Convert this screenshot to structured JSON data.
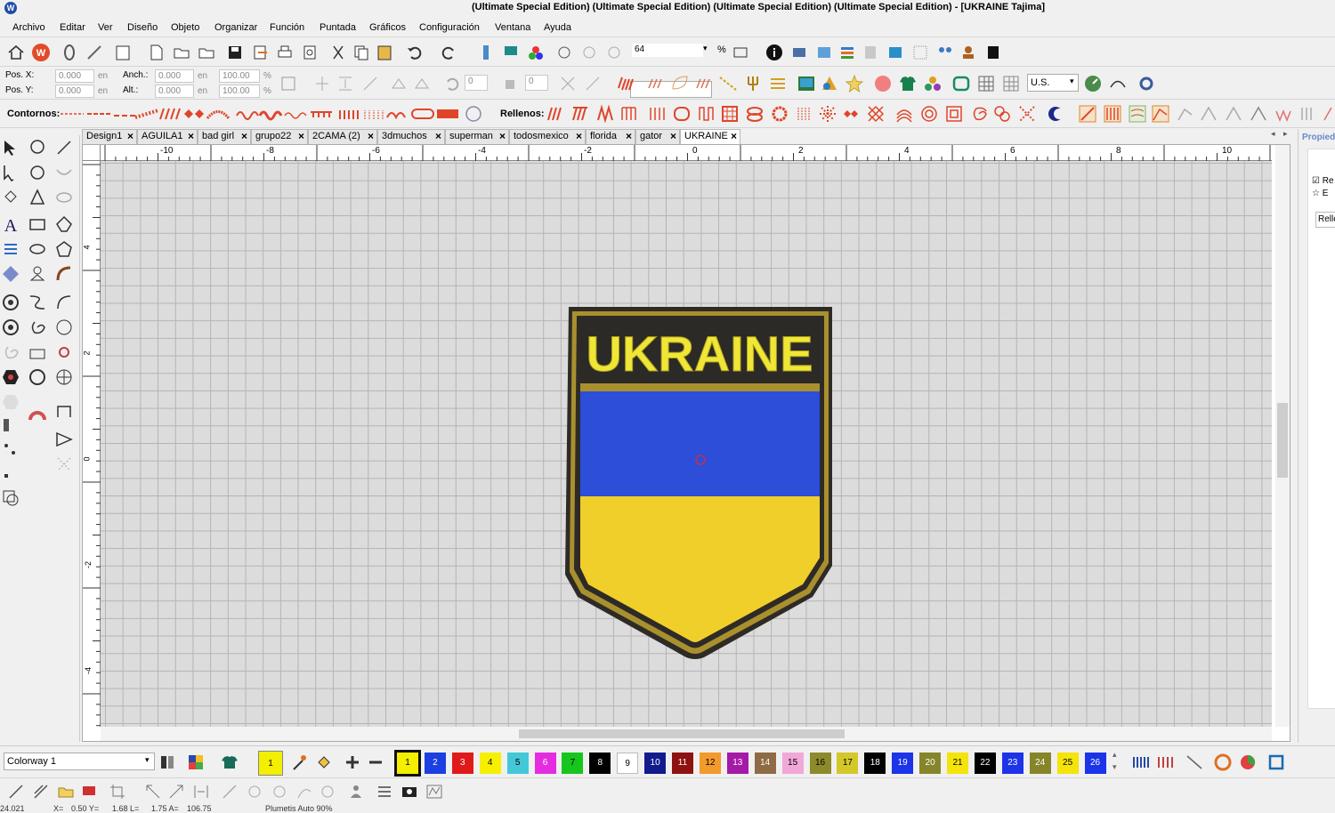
{
  "window": {
    "title": "(Ultimate Special Edition) (Ultimate Special Edition) (Ultimate Special Edition) (Ultimate Special Edition) - [UKRAINE         Tajima]"
  },
  "menu": [
    "Archivo",
    "Editar",
    "Ver",
    "Diseño",
    "Objeto",
    "Organizar",
    "Función",
    "Puntada",
    "Gráficos",
    "Configuración",
    "Ventana",
    "Ayuda"
  ],
  "toolbar1": {
    "zoom_value": "64",
    "zoom_unit": "%"
  },
  "props": {
    "pos_x_label": "Pos. X:",
    "pos_y_label": "Pos. Y:",
    "pos_x": "0.000",
    "pos_y": "0.000",
    "unit": "en",
    "anch_label": "Anch.:",
    "alt_label": "Alt.:",
    "anch": "0.000",
    "alt": "0.000",
    "scale_w": "100.00",
    "scale_h": "100.00",
    "pct": "%",
    "angle": "0",
    "slant": "0",
    "units_select": "U.S."
  },
  "toolbar3": {
    "contornos_label": "Contornos:",
    "rellenos_label": "Rellenos:"
  },
  "tabs": [
    {
      "label": "Design1",
      "active": false
    },
    {
      "label": "AGUILA1",
      "active": false
    },
    {
      "label": "bad girl",
      "active": false
    },
    {
      "label": "grupo22",
      "active": false
    },
    {
      "label": "2CAMA (2)",
      "active": false
    },
    {
      "label": "3dmuchos",
      "active": false
    },
    {
      "label": "superman",
      "active": false
    },
    {
      "label": "todosmexico",
      "active": false
    },
    {
      "label": "florida",
      "active": false
    },
    {
      "label": "gator",
      "active": false
    },
    {
      "label": "UKRAINE",
      "active": true
    }
  ],
  "ruler": {
    "h": [
      "-10",
      "-8",
      "-6",
      "-4",
      "-2",
      "0",
      "2",
      "4",
      "6",
      "8",
      "10"
    ],
    "v": [
      "4",
      "2",
      "0",
      "-2",
      "-4"
    ]
  },
  "design": {
    "text": "UKRAINE",
    "colors": {
      "outline": "#2e2b26",
      "border": "#a9902e",
      "text_bg": "#2b2a27",
      "text": "#f0e636",
      "blue": "#2c4ed8",
      "yellow": "#f0cf2a"
    }
  },
  "right_panel": {
    "title": "Propied",
    "item1": "Re",
    "item2": "E",
    "field": "Relle"
  },
  "colorway": {
    "label": "Colorway 1",
    "current": "1"
  },
  "palette": [
    {
      "n": "1",
      "c": "#f4ee00",
      "t": "#000"
    },
    {
      "n": "2",
      "c": "#1b3fe0",
      "t": "#fff"
    },
    {
      "n": "3",
      "c": "#e01a1a",
      "t": "#fff"
    },
    {
      "n": "4",
      "c": "#f6f000",
      "t": "#000"
    },
    {
      "n": "5",
      "c": "#43c8d8",
      "t": "#000"
    },
    {
      "n": "6",
      "c": "#e42de0",
      "t": "#fff"
    },
    {
      "n": "7",
      "c": "#17c61d",
      "t": "#000"
    },
    {
      "n": "8",
      "c": "#000000",
      "t": "#fff"
    },
    {
      "n": "9",
      "c": "#ffffff",
      "t": "#000"
    },
    {
      "n": "10",
      "c": "#121b8c",
      "t": "#fff"
    },
    {
      "n": "11",
      "c": "#8e1212",
      "t": "#fff"
    },
    {
      "n": "12",
      "c": "#f29a2b",
      "t": "#000"
    },
    {
      "n": "13",
      "c": "#a519a8",
      "t": "#fff"
    },
    {
      "n": "14",
      "c": "#8e6a45",
      "t": "#fff"
    },
    {
      "n": "15",
      "c": "#f0a8d8",
      "t": "#000"
    },
    {
      "n": "16",
      "c": "#8d8a2b",
      "t": "#000"
    },
    {
      "n": "17",
      "c": "#d4c72a",
      "t": "#000"
    },
    {
      "n": "18",
      "c": "#000000",
      "t": "#fff"
    },
    {
      "n": "19",
      "c": "#1c33e8",
      "t": "#fff"
    },
    {
      "n": "20",
      "c": "#86852a",
      "t": "#fff"
    },
    {
      "n": "21",
      "c": "#f4e40a",
      "t": "#000"
    },
    {
      "n": "22",
      "c": "#000000",
      "t": "#fff"
    },
    {
      "n": "23",
      "c": "#1c33e8",
      "t": "#fff"
    },
    {
      "n": "24",
      "c": "#86852a",
      "t": "#fff"
    },
    {
      "n": "25",
      "c": "#f4e40a",
      "t": "#000"
    },
    {
      "n": "26",
      "c": "#1c33e8",
      "t": "#fff"
    }
  ],
  "status": {
    "coord": "24.021",
    "x_label": "X=",
    "x": "0.50 Y=",
    "y": "1.68 L=",
    "l": "1.75 A=",
    "a": "106.75",
    "mode": "Plumetis Auto 90%"
  }
}
